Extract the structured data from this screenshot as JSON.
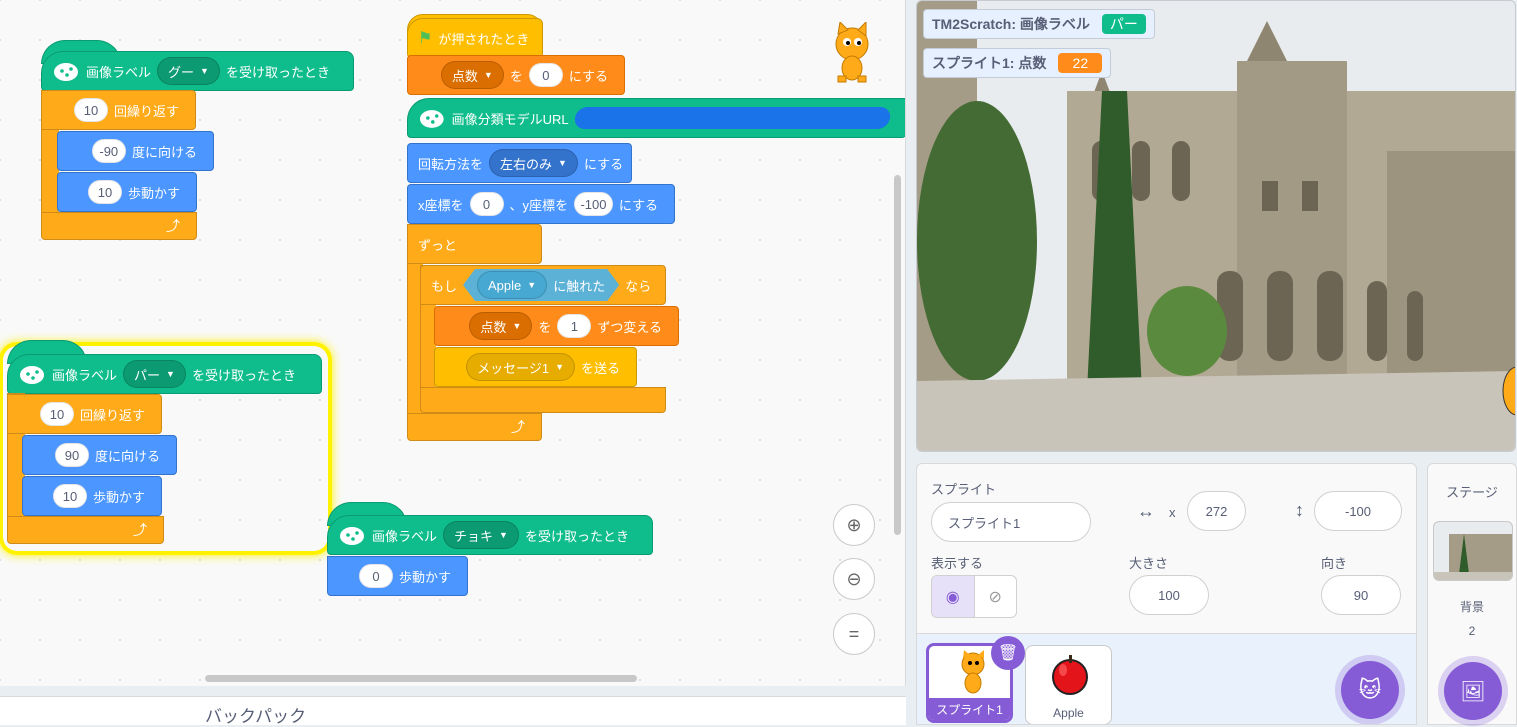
{
  "scripts": {
    "goo": {
      "hat_prefix": "画像ラベル",
      "hat_value": "グー",
      "hat_suffix": "を受け取ったとき",
      "repeat_count": "10",
      "repeat_label": "回繰り返す",
      "point_value": "-90",
      "point_label": "度に向ける",
      "move_value": "10",
      "move_label": "歩動かす"
    },
    "paa": {
      "hat_prefix": "画像ラベル",
      "hat_value": "パー",
      "hat_suffix": "を受け取ったとき",
      "repeat_count": "10",
      "repeat_label": "回繰り返す",
      "point_value": "90",
      "point_label": "度に向ける",
      "move_value": "10",
      "move_label": "歩動かす"
    },
    "choki": {
      "hat_prefix": "画像ラベル",
      "hat_value": "チョキ",
      "hat_suffix": "を受け取ったとき",
      "move_value": "0",
      "move_label": "歩動かす"
    },
    "main": {
      "flag_label": "が押されたとき",
      "set_var": "点数",
      "set_to": "を",
      "set_value": "0",
      "set_suffix": "にする",
      "model_url_label": "画像分類モデルURL",
      "rotation_prefix": "回転方法を",
      "rotation_value": "左右のみ",
      "rotation_suffix": "にする",
      "x_label": "x座標を",
      "x_value": "0",
      "y_label": "、y座標を",
      "y_value": "-100",
      "xy_suffix": "にする",
      "forever_label": "ずっと",
      "if_label": "もし",
      "touch_target": "Apple",
      "touch_label": "に触れた",
      "then_label": "なら",
      "change_var": "点数",
      "change_by": "を",
      "change_value": "1",
      "change_suffix": "ずつ変える",
      "broadcast_value": "メッセージ1",
      "broadcast_label": "を送る"
    }
  },
  "backpack_label": "バックパック",
  "stage": {
    "monitor1_label": "TM2Scratch: 画像ラベル",
    "monitor1_value": "パー",
    "monitor2_label": "スプライト1: 点数",
    "monitor2_value": "22"
  },
  "sprite_info": {
    "sprite_label": "スプライト",
    "sprite_name": "スプライト1",
    "x_label": "x",
    "x_value": "272",
    "y_label": "y",
    "y_value": "-100",
    "show_label": "表示する",
    "size_label": "大きさ",
    "size_value": "100",
    "direction_label": "向き",
    "direction_value": "90"
  },
  "sprites": [
    {
      "name": "スプライト1"
    },
    {
      "name": "Apple"
    }
  ],
  "stage_pane": {
    "title": "ステージ",
    "backdrop_label": "背景",
    "backdrop_count": "2"
  },
  "colors": {
    "events": "#0fbd8c",
    "control": "#ffab19",
    "motion": "#4c97ff",
    "variables": "#ff8c1a",
    "accent": "#855cd6"
  }
}
